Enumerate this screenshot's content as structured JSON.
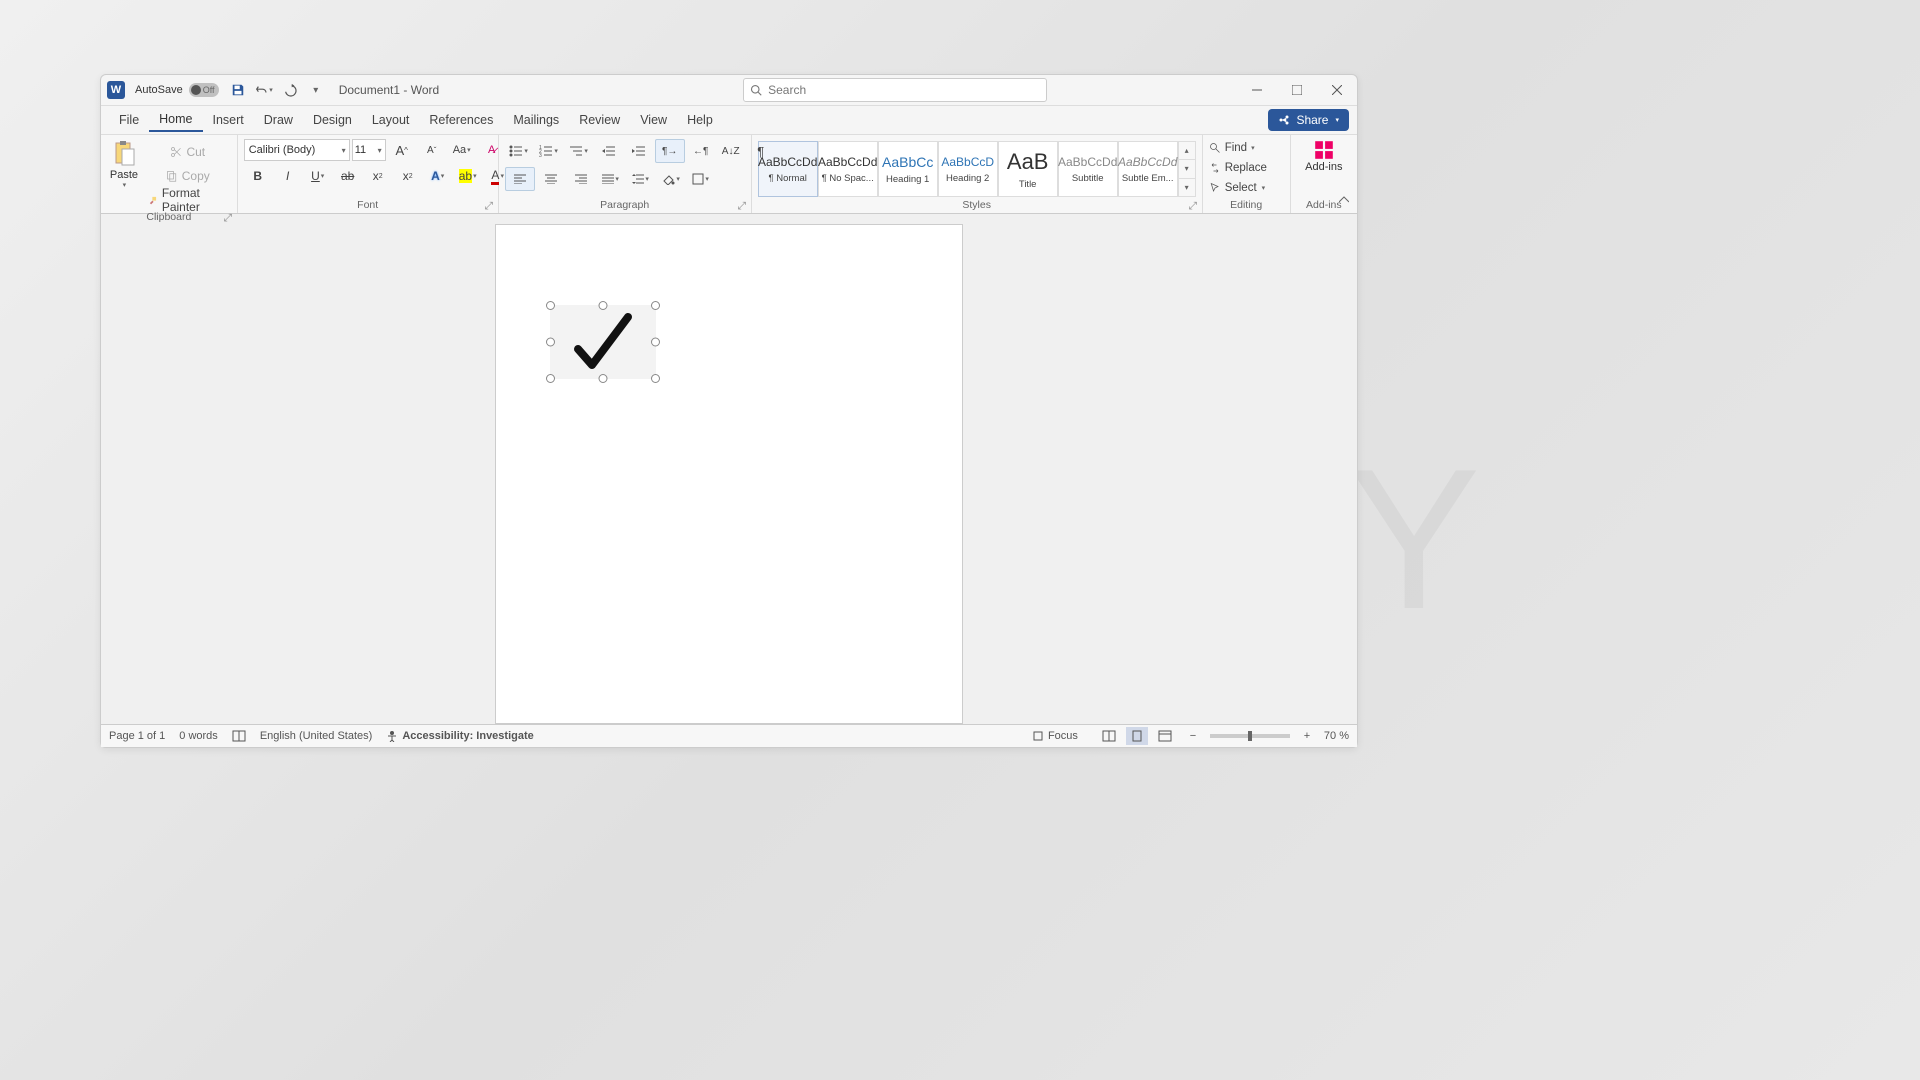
{
  "titlebar": {
    "autosave_label": "AutoSave",
    "autosave_state": "Off",
    "doc_title": "Document1  -  Word",
    "search_placeholder": "Search"
  },
  "tabs": {
    "file": "File",
    "home": "Home",
    "insert": "Insert",
    "draw": "Draw",
    "design": "Design",
    "layout": "Layout",
    "references": "References",
    "mailings": "Mailings",
    "review": "Review",
    "view": "View",
    "help": "Help",
    "share": "Share"
  },
  "ribbon": {
    "clipboard": {
      "paste": "Paste",
      "cut": "Cut",
      "copy": "Copy",
      "format_painter": "Format Painter",
      "title": "Clipboard"
    },
    "font": {
      "name": "Calibri (Body)",
      "size": "11",
      "title": "Font"
    },
    "paragraph": {
      "title": "Paragraph"
    },
    "styles": {
      "title": "Styles",
      "items": [
        {
          "preview": "AaBbCcDd",
          "name": "¶ Normal"
        },
        {
          "preview": "AaBbCcDd",
          "name": "¶ No Spac..."
        },
        {
          "preview": "AaBbCc",
          "name": "Heading 1"
        },
        {
          "preview": "AaBbCcD",
          "name": "Heading 2"
        },
        {
          "preview": "AaB",
          "name": "Title"
        },
        {
          "preview": "AaBbCcDd",
          "name": "Subtitle"
        },
        {
          "preview": "AaBbCcDd",
          "name": "Subtle Em..."
        }
      ]
    },
    "editing": {
      "find": "Find",
      "replace": "Replace",
      "select": "Select",
      "title": "Editing"
    },
    "addins": {
      "label": "Add-ins",
      "title": "Add-ins"
    }
  },
  "status": {
    "page": "Page 1 of 1",
    "words": "0 words",
    "lang": "English (United States)",
    "accessibility": "Accessibility: Investigate",
    "focus": "Focus",
    "zoom": "70 %"
  }
}
